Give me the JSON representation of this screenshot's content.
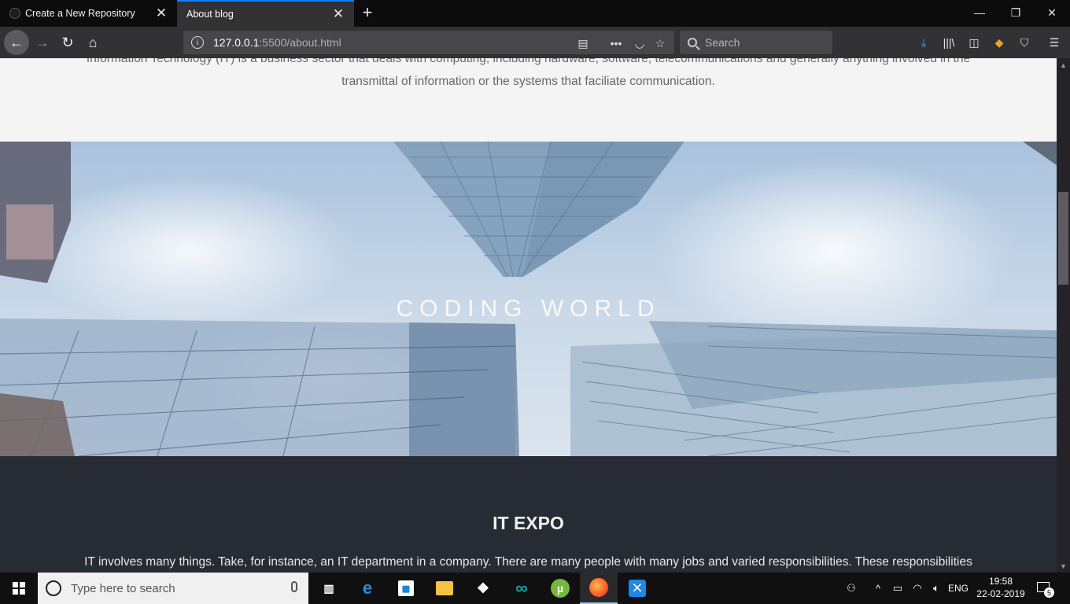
{
  "browser": {
    "tabs": [
      {
        "title": "Create a New Repository",
        "active": false
      },
      {
        "title": "About blog",
        "active": true
      }
    ],
    "url_host": "127.0.0.1",
    "url_rest": ":5500/about.html",
    "search_placeholder": "Search",
    "accent_color": "#0a84ff"
  },
  "page": {
    "intro_line1": "Information Technology (IT) is a business sector that deals with computing, including hardware, software, telecommunications and generally anything involved in the",
    "intro_line2": "transmittal of information or the systems that faciliate communication.",
    "hero_title": "CODING WORLD",
    "expo_title": "IT EXPO",
    "expo_text": "IT involves many things. Take, for instance, an IT department in a company. There are many people with many jobs and varied responsibilities. These responsibilities"
  },
  "taskbar": {
    "search_placeholder": "Type here to search",
    "language": "ENG",
    "time": "19:58",
    "date": "22-02-2019",
    "notification_count": "5",
    "apps": [
      "task-view",
      "edge",
      "store",
      "file-explorer",
      "dropbox",
      "arduino",
      "utorrent",
      "firefox",
      "vscode"
    ]
  }
}
